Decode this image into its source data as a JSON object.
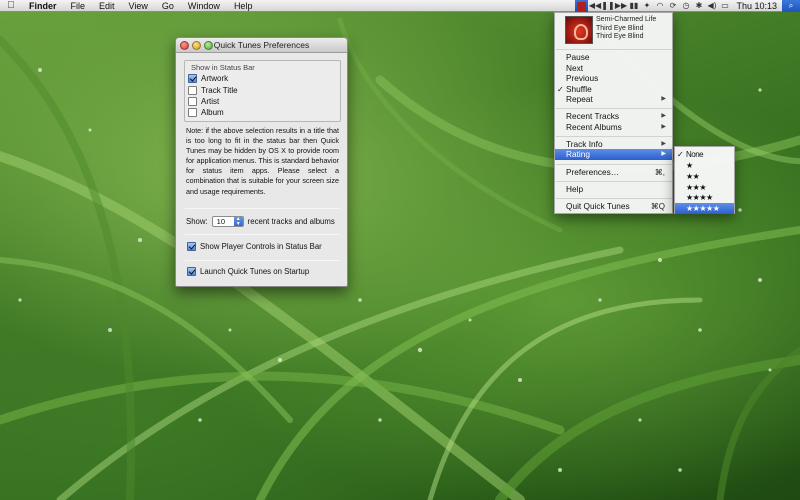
{
  "menubar": {
    "apple_icon": "apple-icon",
    "app_name": "Finder",
    "menus": [
      "File",
      "Edit",
      "View",
      "Go",
      "Window",
      "Help"
    ],
    "status_icons": [
      "quick-tunes-icon",
      "previous-track-icon",
      "pause-icon",
      "next-track-icon",
      "volume-bars-icon",
      "dropbox-icon",
      "airport-wifi-icon",
      "sync-icon",
      "time-machine-icon",
      "bluetooth-icon",
      "volume-icon",
      "battery-icon"
    ],
    "clock": "Thu 10:13",
    "spotlight_icon": "spotlight-icon"
  },
  "prefs_window": {
    "title": "Quick Tunes Preferences",
    "group_title": "Show in Status Bar",
    "options": [
      {
        "label": "Artwork",
        "checked": true
      },
      {
        "label": "Track Title",
        "checked": false
      },
      {
        "label": "Artist",
        "checked": false
      },
      {
        "label": "Album",
        "checked": false
      }
    ],
    "note": "Note: if the above selection results in a title that is too long to fit in the status bar then Quick Tunes may be hidden by OS X to provide room for application menus. This is standard behavior for status item apps. Please select a combination that is suitable for your screen size and usage requirements.",
    "show_label": "Show:",
    "show_count": "10",
    "show_suffix": "recent tracks and albums",
    "player_controls_label": "Show Player Controls in Status Bar",
    "player_controls_checked": true,
    "launch_label": "Launch Quick Tunes on Startup",
    "launch_checked": true
  },
  "quick_tunes_menu": {
    "now_playing": {
      "track": "Semi-Charmed Life",
      "artist": "Third Eye Blind",
      "album": "Third Eye Blind"
    },
    "items": {
      "pause": "Pause",
      "next": "Next",
      "previous": "Previous",
      "shuffle": "Shuffle",
      "repeat": "Repeat",
      "recent_tracks": "Recent Tracks",
      "recent_albums": "Recent Albums",
      "track_info": "Track Info",
      "rating": "Rating",
      "preferences": "Preferences…",
      "preferences_shortcut": "⌘,",
      "help": "Help",
      "quit": "Quit Quick Tunes",
      "quit_shortcut": "⌘Q"
    },
    "check_mark": "✓",
    "submenu_arrow": "▶"
  },
  "rating_menu": {
    "items": [
      "None",
      "★",
      "★★",
      "★★★",
      "★★★★",
      "★★★★★"
    ],
    "checked_index": 0,
    "highlighted_index": 5
  },
  "colors": {
    "selection": "#2b5fd0",
    "wallpaper": "#467f28"
  }
}
